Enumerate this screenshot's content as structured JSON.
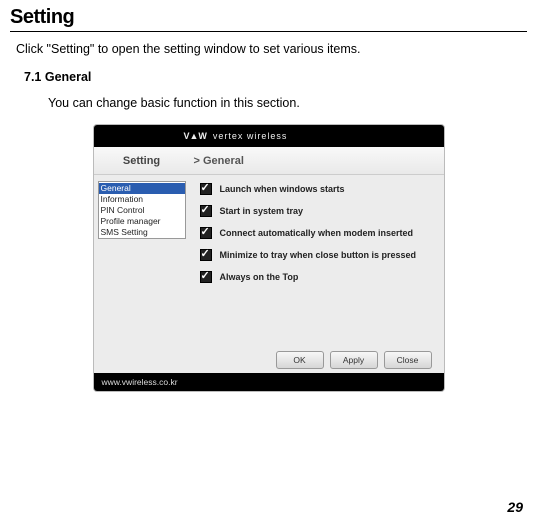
{
  "page": {
    "title": "Setting",
    "intro": "Click \"Setting\" to open the setting window to set various items.",
    "section_number": "7.1 General",
    "section_body": "You can change basic function in this section.",
    "page_number": "29"
  },
  "screenshot": {
    "brand_logo": "V▲W",
    "brand_text": "vertex wireless",
    "header_left": "Setting",
    "header_right": "> General",
    "sidebar_items": [
      "General",
      "Information",
      "PIN Control",
      "Profile manager",
      "SMS Setting"
    ],
    "options": [
      "Launch when windows starts",
      "Start in system tray",
      "Connect automatically when modem inserted",
      "Minimize to tray when close button is pressed",
      "Always on the Top"
    ],
    "buttons": {
      "ok": "OK",
      "apply": "Apply",
      "close": "Close"
    },
    "footer": "www.vwireless.co.kr"
  }
}
